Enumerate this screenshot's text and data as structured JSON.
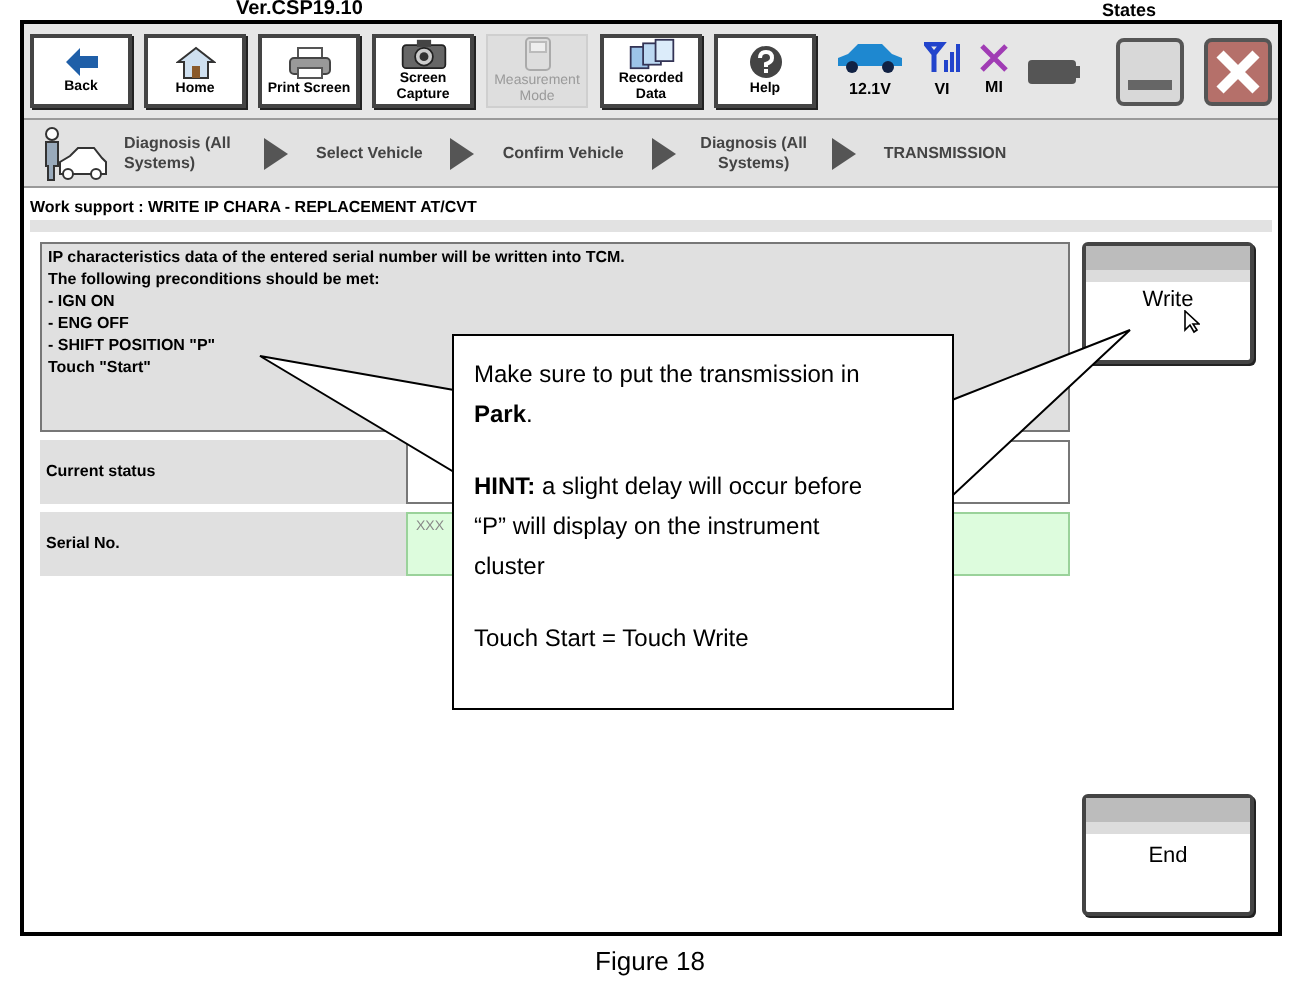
{
  "header": {
    "version": "Ver.CSP19.10",
    "states_label": "States"
  },
  "toolbar": [
    {
      "label": "Back",
      "kind": "back",
      "disabled": false
    },
    {
      "label": "Home",
      "kind": "home",
      "disabled": false
    },
    {
      "label": "Print Screen",
      "kind": "print",
      "disabled": false
    },
    {
      "label": "Screen Capture",
      "kind": "camera",
      "disabled": false
    },
    {
      "label": "Measurement Mode",
      "kind": "measure",
      "disabled": true
    },
    {
      "label": "Recorded Data",
      "kind": "data",
      "disabled": false
    },
    {
      "label": "Help",
      "kind": "help",
      "disabled": false
    }
  ],
  "status": [
    {
      "label": "12.1V",
      "kind": "car"
    },
    {
      "label": "VI",
      "kind": "vi"
    },
    {
      "label": "MI",
      "kind": "mi"
    },
    {
      "kind": "battery"
    }
  ],
  "breadcrumbs": [
    "Diagnosis (All Systems)",
    "Select Vehicle",
    "Confirm Vehicle",
    "Diagnosis (All Systems)",
    "TRANSMISSION"
  ],
  "work_support_title": "Work support : WRITE IP CHARA - REPLACEMENT AT/CVT",
  "message_lines": [
    "IP characteristics data of the entered serial number will be written into TCM.",
    "The following preconditions should be met:",
    "- IGN ON",
    "- ENG OFF",
    "- SHIFT POSITION \"P\"",
    "Touch \"Start\""
  ],
  "write_button": "Write",
  "fields": [
    {
      "label": "Current status",
      "highlighted": false
    },
    {
      "label": "Serial No.",
      "value": "XXX",
      "highlighted": true
    }
  ],
  "end_button": "End",
  "callout": {
    "paragraphs": [
      "Make sure to put the transmission in **Park**.",
      "**HINT:** a slight delay will occur before “P” will display on the instrument cluster",
      "Touch Start = Touch Write"
    ]
  },
  "caption": "Figure 18"
}
